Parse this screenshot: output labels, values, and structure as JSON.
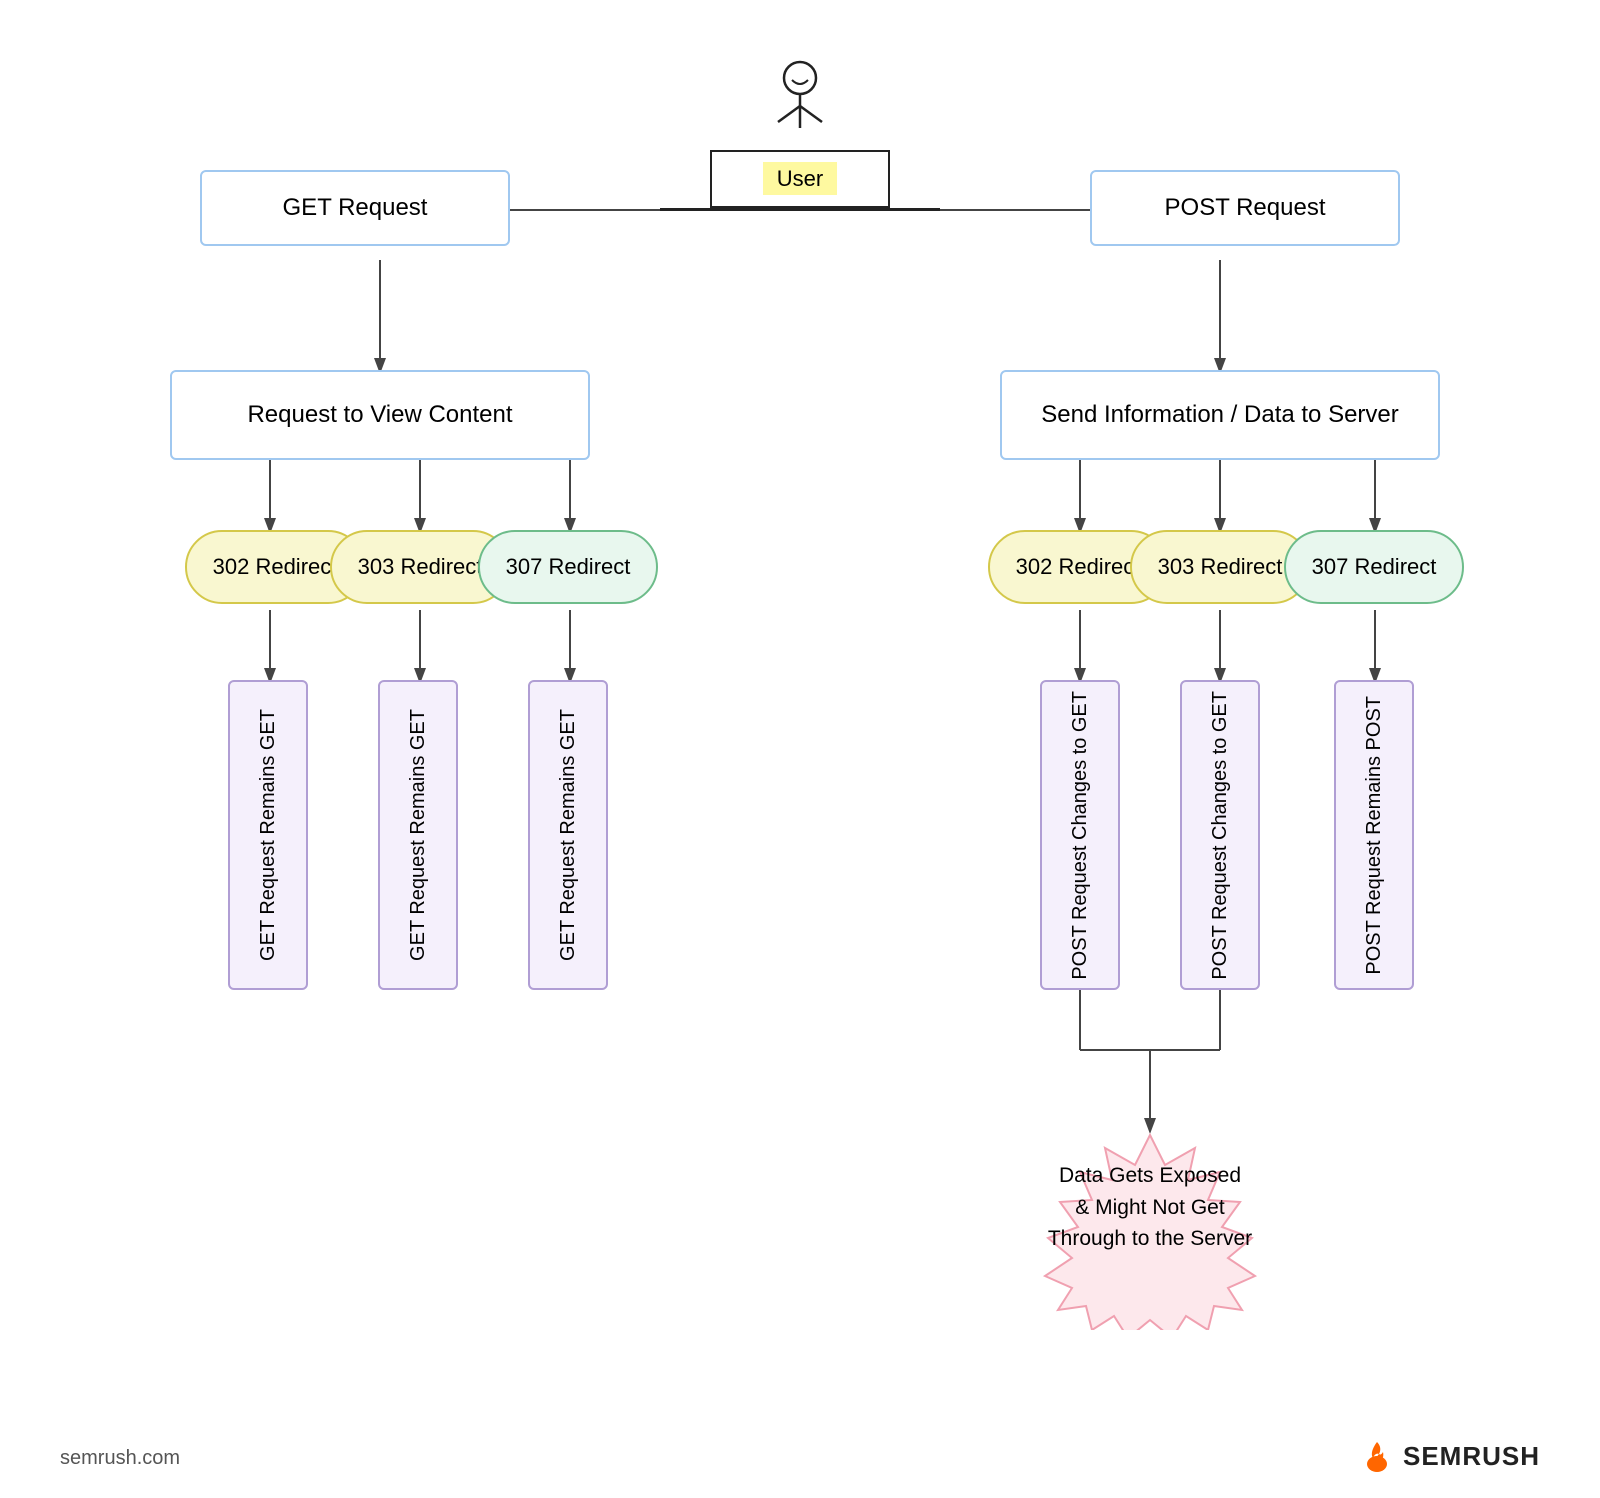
{
  "user": {
    "label": "User"
  },
  "get_request": "GET Request",
  "post_request": "POST Request",
  "request_view": "Request to View Content",
  "send_info": "Send Information / Data to Server",
  "left": {
    "redirects": [
      "302 Redirect",
      "303 Redirect",
      "307 Redirect"
    ],
    "results": [
      "GET Request Remains GET",
      "GET Request Remains GET",
      "GET Request Remains GET"
    ]
  },
  "right": {
    "redirects": [
      "302 Redirect",
      "303 Redirect",
      "307 Redirect"
    ],
    "results": [
      "POST Request Changes to GET",
      "POST Request Changes to GET",
      "POST Request Remains POST"
    ]
  },
  "warning": "Data Gets Exposed\n& Might Not Get\nThrough to the Server",
  "semrush_url": "semrush.com",
  "semrush_brand": "SEMRUSH"
}
